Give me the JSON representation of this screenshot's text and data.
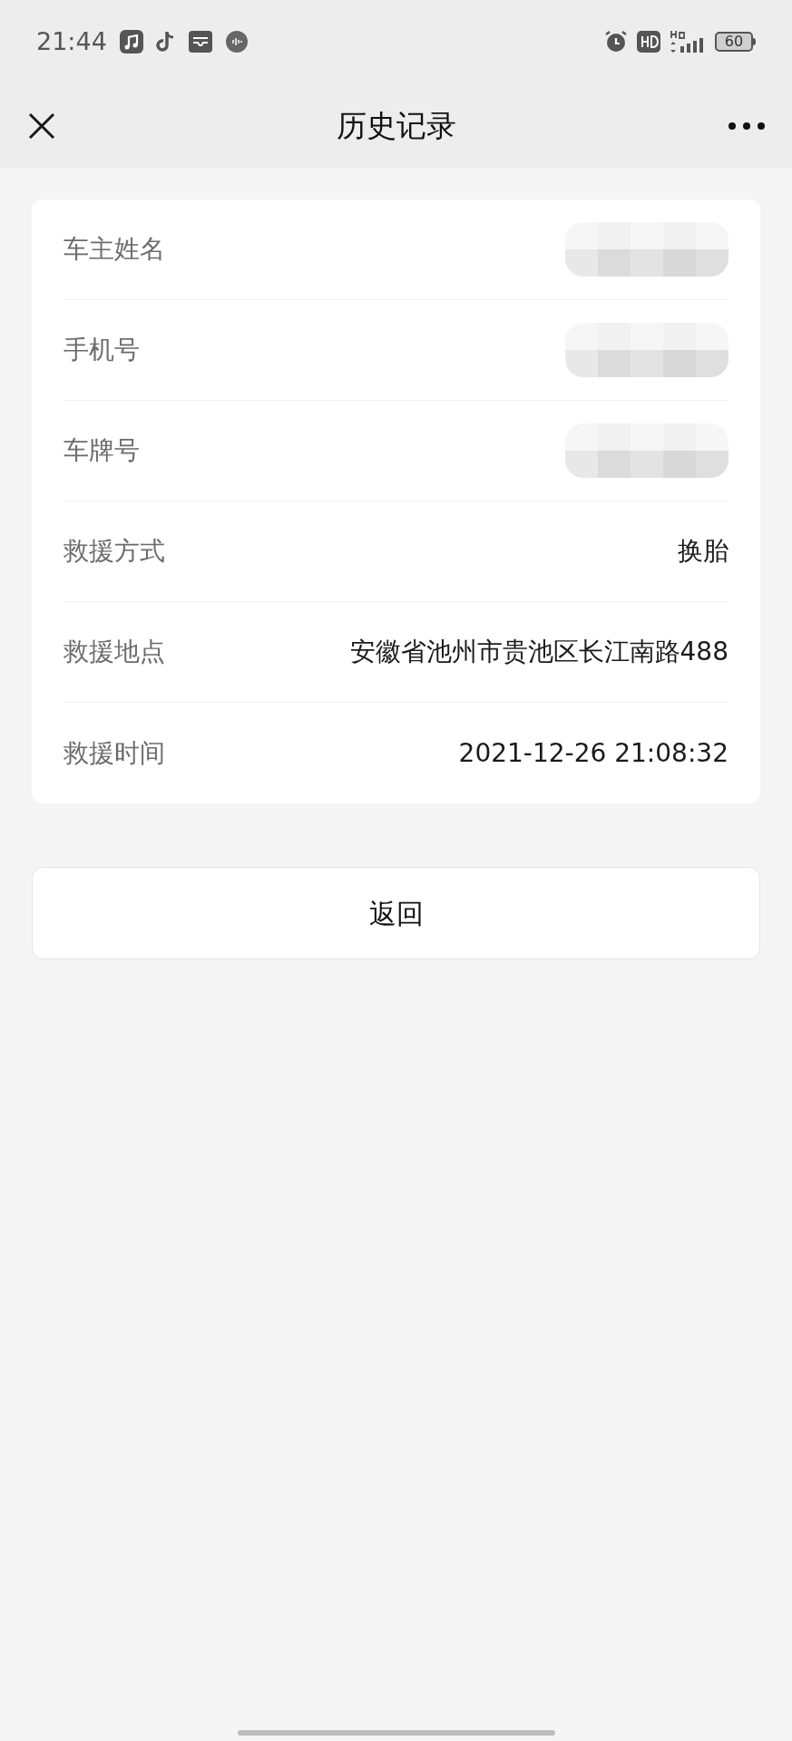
{
  "status_bar": {
    "time": "21:44",
    "battery": "60"
  },
  "nav": {
    "title": "历史记录"
  },
  "rows": [
    {
      "label": "车主姓名",
      "kind": "redacted"
    },
    {
      "label": "手机号",
      "kind": "redacted"
    },
    {
      "label": "车牌号",
      "kind": "redacted"
    },
    {
      "label": "救援方式",
      "kind": "text",
      "value": "换胎"
    },
    {
      "label": "救援地点",
      "kind": "text",
      "value": "安徽省池州市贵池区长江南路488"
    },
    {
      "label": "救援时间",
      "kind": "text",
      "value": "2021-12-26 21:08:32"
    }
  ],
  "back_button": "返回"
}
